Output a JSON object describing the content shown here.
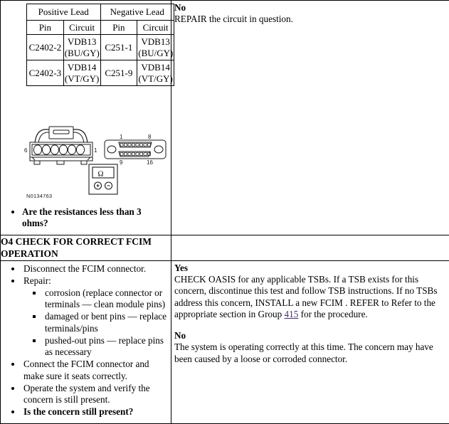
{
  "pin_table": {
    "group_headers": [
      "Positive Lead",
      "Negative Lead"
    ],
    "sub_headers": [
      "Pin",
      "Circuit",
      "Pin",
      "Circuit"
    ],
    "rows": [
      [
        "C2402-2",
        "VDB13 (BU/GY)",
        "C251-1",
        "VDB13 (BU/GY)"
      ],
      [
        "C2402-3",
        "VDB14 (VT/GY)",
        "C251-9",
        "VDB14 (VT/GY)"
      ]
    ]
  },
  "figure": {
    "id_label": "N0134763",
    "left_connector": {
      "pin_left_label": "6",
      "pin_right_label": "1",
      "cavity_count": 6
    },
    "right_connector": {
      "top_left_label": "1",
      "top_right_label": "8",
      "bottom_left_label": "9",
      "bottom_right_label": "16"
    },
    "meter": {
      "display_symbol": "Ω",
      "button_left": "+",
      "button_right": "−"
    }
  },
  "step_03": {
    "question": "Are the resistances less than 3 ohms?",
    "result_no": {
      "label": "No",
      "text": "REPAIR the circuit in question."
    }
  },
  "step_04": {
    "header": "O4 CHECK FOR CORRECT FCIM OPERATION",
    "bullets": [
      "Disconnect the FCIM connector.",
      "Repair:",
      "Connect the FCIM connector and make sure it seats correctly.",
      "Operate the system and verify the concern is still present."
    ],
    "repair_sub_bullets": [
      "corrosion (replace connector or terminals — clean module pins)",
      "damaged or bent pins — replace terminals/pins",
      "pushed-out pins — replace pins as necessary"
    ],
    "question": "Is the concern still present?",
    "result_yes": {
      "label": "Yes",
      "text_before_link": "CHECK OASIS for any applicable TSBs. If a TSB exists for this concern, discontinue this test and follow TSB instructions. If no TSBs address this concern, INSTALL a new FCIM . REFER to Refer to the appropriate section in Group ",
      "link_text": "415",
      "text_after_link": " for the procedure."
    },
    "result_no": {
      "label": "No",
      "text": "The system is operating correctly at this time. The concern may have been caused by a loose or corroded connector."
    }
  },
  "colors": {
    "link": "#4a2d7a",
    "border": "#000000",
    "text": "#000000"
  }
}
